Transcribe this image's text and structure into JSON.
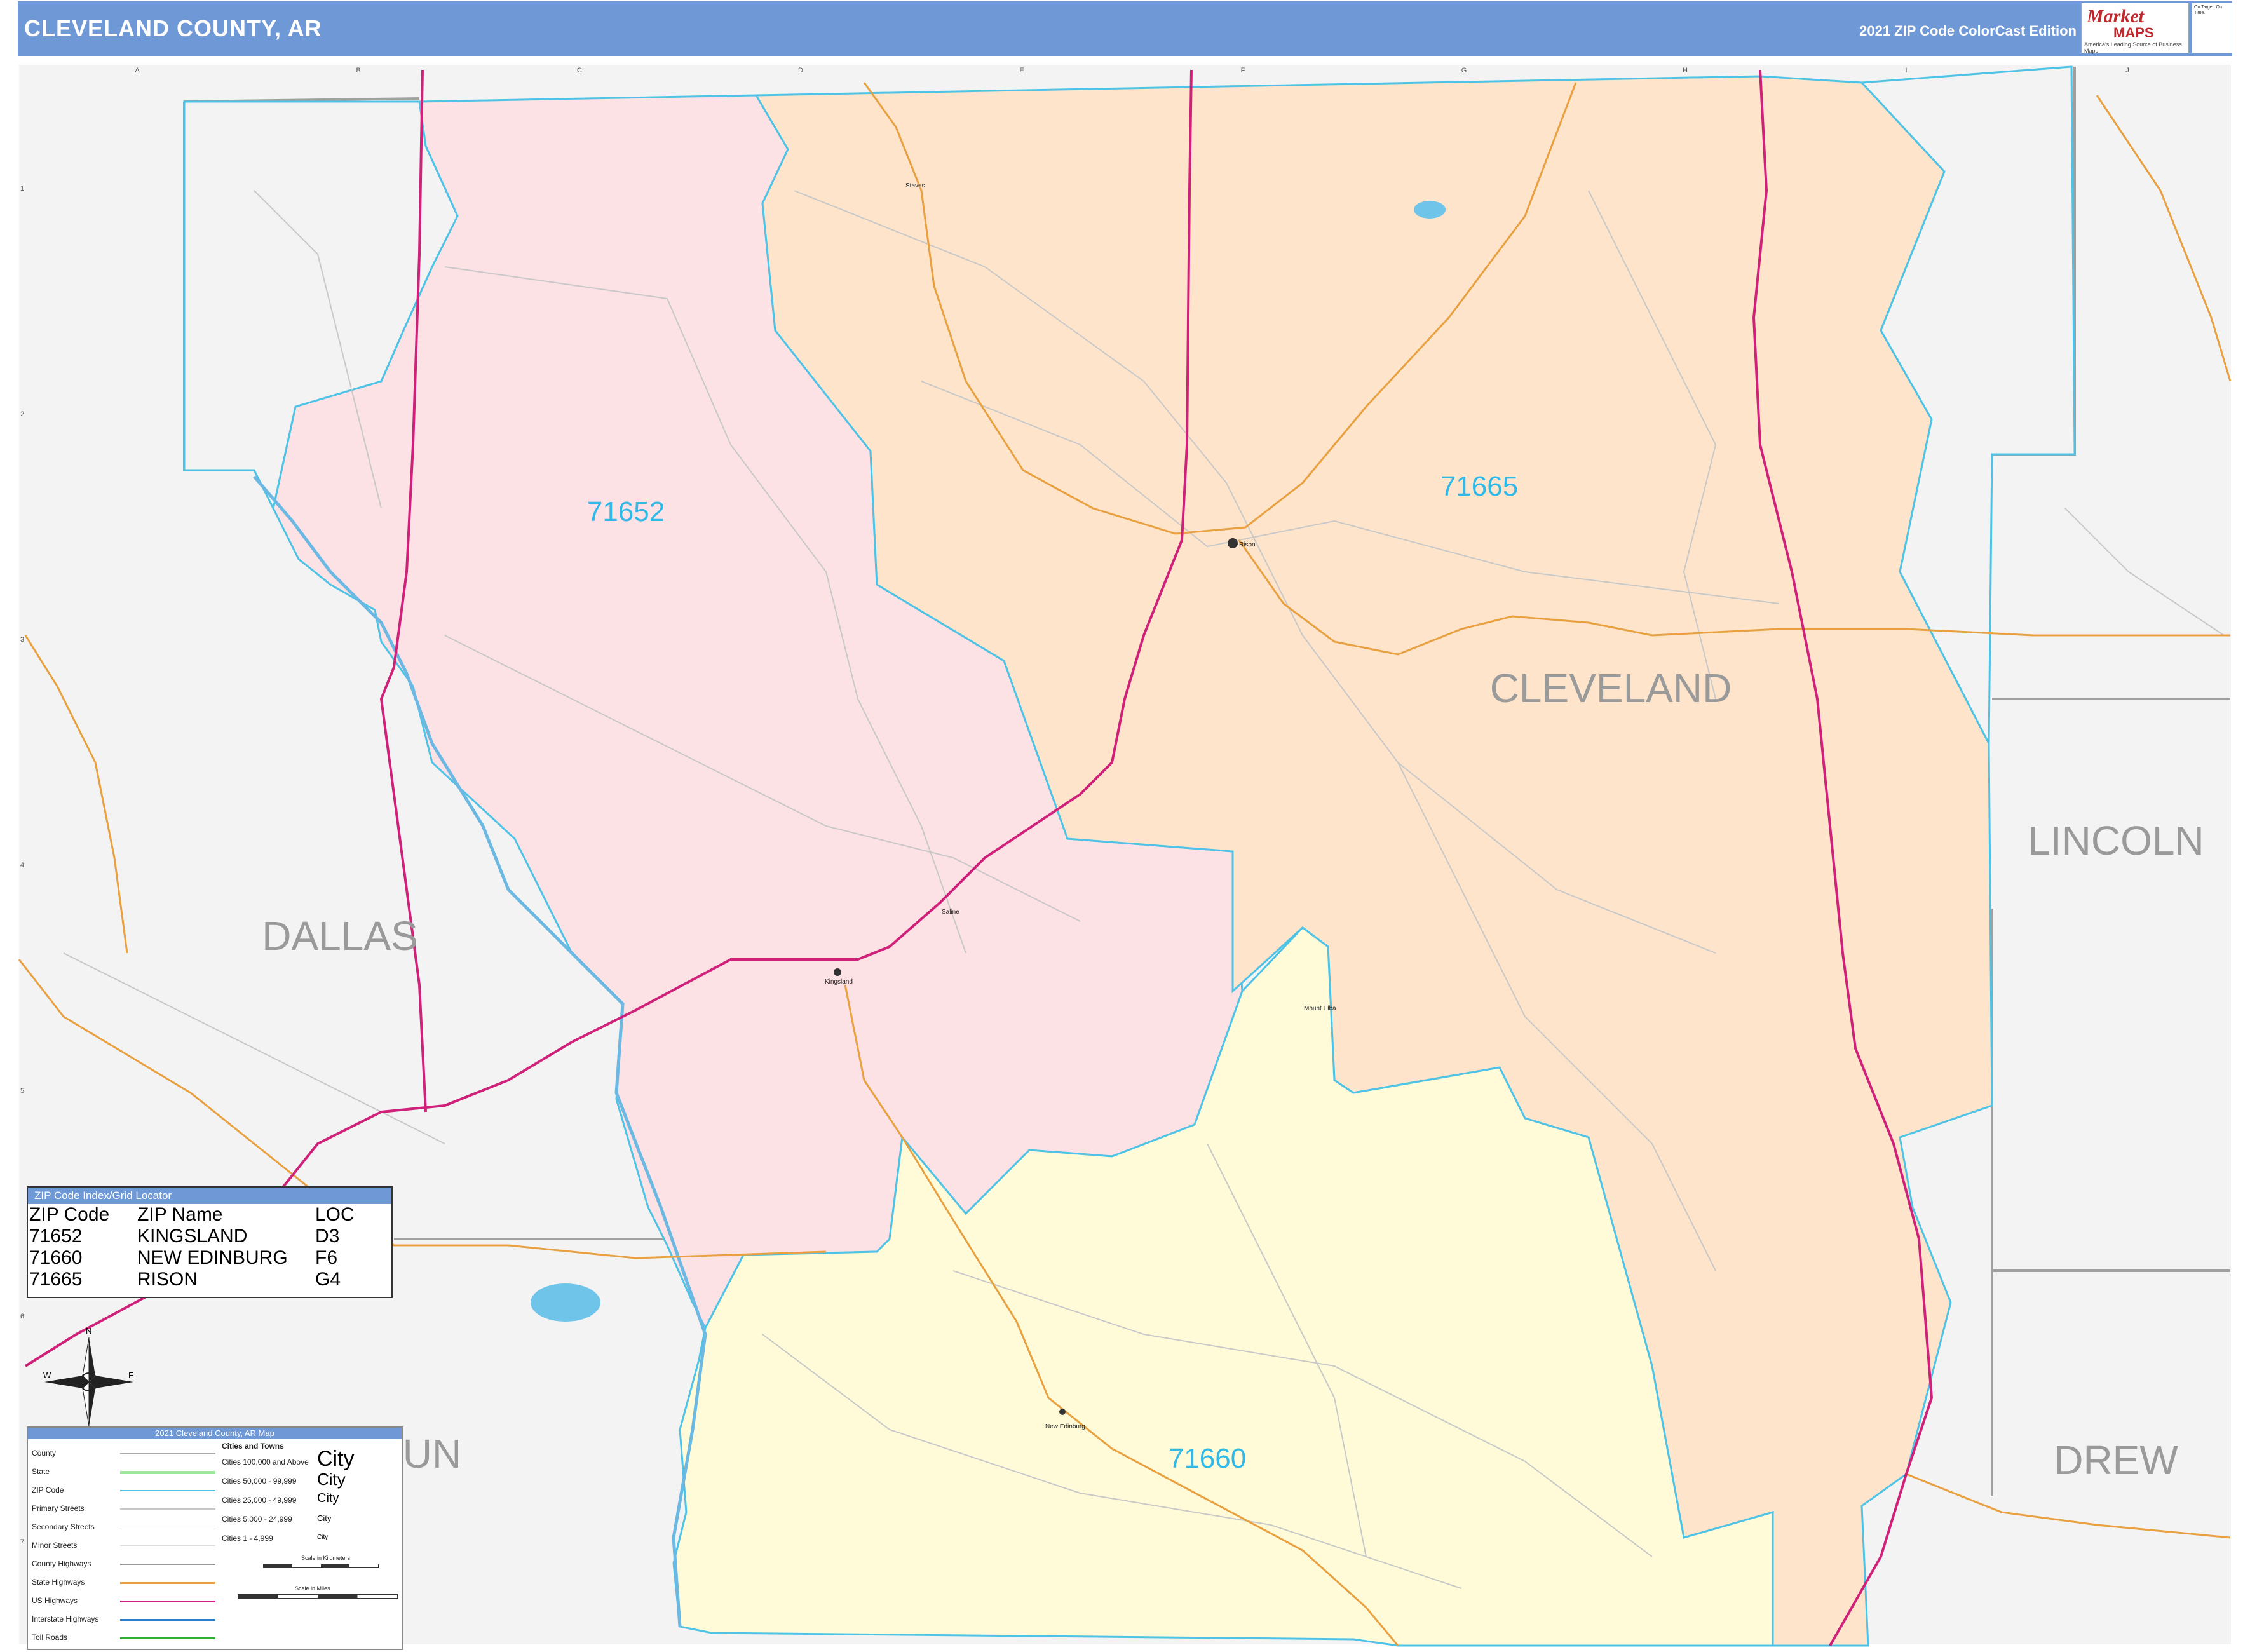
{
  "header": {
    "title": "CLEVELAND COUNTY, AR",
    "edition": "2021 ZIP Code ColorCast Edition",
    "brand_name_1": "Market",
    "brand_name_2": "MAPS",
    "brand_tagline": "America's Leading Source of Business Maps",
    "brand_small": "On Target. On Time."
  },
  "colors": {
    "header_blue": "#6f98d6",
    "zip_71652": "#fce1e5",
    "zip_71665": "#fde4cb",
    "zip_71660": "#fffbd8",
    "zip_border": "#4ec3e6",
    "outside": "#f3f3f3",
    "us_highway": "#d0217a",
    "state_highway": "#e8a040",
    "zip_label": "#2fb9e8"
  },
  "map": {
    "county_labels": [
      "CLEVELAND",
      "DALLAS",
      "LINCOLN",
      "DREW",
      "UN"
    ],
    "zip_labels": [
      "71652",
      "71665",
      "71660"
    ],
    "towns": [
      "Staves",
      "Rison",
      "Kingsland",
      "Saline",
      "Mount Elba",
      "New Edinburg"
    ],
    "grid_columns": [
      "A",
      "B",
      "C",
      "D",
      "E",
      "F",
      "G",
      "H",
      "I",
      "J"
    ],
    "grid_rows": [
      "1",
      "2",
      "3",
      "4",
      "5",
      "6",
      "7"
    ],
    "compass": [
      "N",
      "S",
      "E",
      "W"
    ]
  },
  "zip_index": {
    "title": "ZIP Code Index/Grid Locator",
    "headers": [
      "ZIP Code",
      "ZIP Name",
      "LOC"
    ],
    "rows": [
      [
        "71652",
        "KINGSLAND",
        "D3"
      ],
      [
        "71660",
        "NEW EDINBURG",
        "F6"
      ],
      [
        "71665",
        "RISON",
        "G4"
      ]
    ]
  },
  "legend": {
    "title": "2021 Cleveland County, AR Map",
    "items": [
      "County",
      "State",
      "ZIP Code",
      "Primary Streets",
      "Secondary Streets",
      "Minor Streets",
      "County Highways",
      "State Highways",
      "US Highways",
      "Interstate Highways",
      "Toll Roads"
    ],
    "cities_title": "Cities and Towns",
    "city_sizes": [
      "Cities 100,000 and Above",
      "Cities 50,000 - 99,999",
      "Cities 25,000 - 49,999",
      "Cities 5,000 - 24,999",
      "Cities 1 - 4,999"
    ],
    "city_symbol": "City",
    "scale_km": "Scale in Kilometers",
    "scale_mi": "Scale in Miles"
  }
}
